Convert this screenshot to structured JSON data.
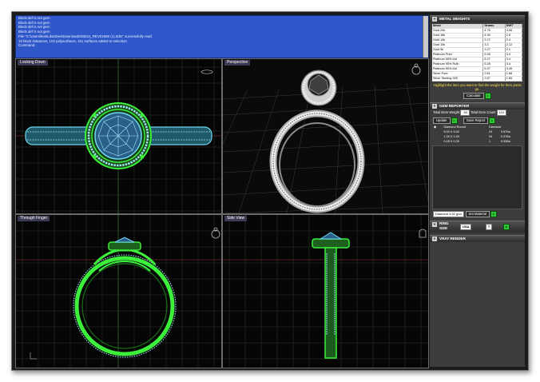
{
  "command_log": {
    "lines": [
      "Block def is not gem",
      "Block def is not gem",
      "Block def is not gem",
      "Block def is not gem",
      "File \"C:\\Users\\leela.dambes\\Downloads\\83611_REV01958 (1).3dm\" successfully read",
      "10 block instances, 102 polysurfaces, 411 surfaces added to selection"
    ],
    "prompt_label": "Command:"
  },
  "viewports": {
    "top_left": {
      "label": "Looking Down"
    },
    "top_right": {
      "label": "Perspective"
    },
    "bottom_left": {
      "label": "Through Finger"
    },
    "bottom_right": {
      "label": "Side View"
    }
  },
  "metal_weights": {
    "title": "METAL WEIGHTS",
    "columns": [
      "Metal",
      "Grams",
      "DWT"
    ],
    "rows": [
      [
        "Gold 24k",
        "4.76",
        "3.06"
      ],
      [
        "Gold 18k",
        "4.36",
        "2.8"
      ],
      [
        "Gold 14k",
        "3.72",
        "2.4"
      ],
      [
        "Gold 10k",
        "3.3",
        "2.12"
      ],
      [
        "Gold 9k",
        "3.27",
        "2.1"
      ],
      [
        "Platinum Pure",
        "5.28",
        "3.4"
      ],
      [
        "Platinum 95% Irid",
        "5.27",
        "3.4"
      ],
      [
        "Platinum 95% Ruth",
        "5.28",
        "3.4"
      ],
      [
        "Platinum 90% Irid",
        "5.37",
        "3.45"
      ],
      [
        "Silver Pure",
        "2.61",
        "1.68"
      ],
      [
        "Silver Sterling 925",
        "2.57",
        "1.65"
      ]
    ],
    "hint": "Highlight the item you want to find the weight for then press go.",
    "calculate_label": "Calculate"
  },
  "gem_reporter": {
    "title": "GEM REPORTER",
    "total_weight_label": "Total Gem Weight",
    "total_weight_value": ".94",
    "total_count_label": "Total Gem Count",
    "total_count_value": "119",
    "update_label": "Update",
    "save_report_label": "Save Report",
    "header_shape": "Diamond Round",
    "header_material": "Diamond",
    "rows": [
      {
        "size": "5.00 X 5.00",
        "count": "24",
        "weight": "0.570w"
      },
      {
        "size": "1.00 X 1.00",
        "count": "94",
        "weight": "0.370w"
      },
      {
        "size": "0.25 X 0.25",
        "count": "1",
        "weight": "0.330w"
      }
    ]
  },
  "material": {
    "select_value": "Diamond   3.52 g/cc",
    "set_material_label": "Set Material"
  },
  "ring_size": {
    "label_ring": "RING",
    "label_size": "SIZE",
    "region_value": "USA",
    "size_value": "7"
  },
  "vray_title": "VRAY RENDER",
  "colors": {
    "command_bg": "#2e57c9",
    "wire_green": "#3cf03c",
    "wire_blue": "#6ed8f0",
    "gold_highlight": "#ffd23c"
  }
}
